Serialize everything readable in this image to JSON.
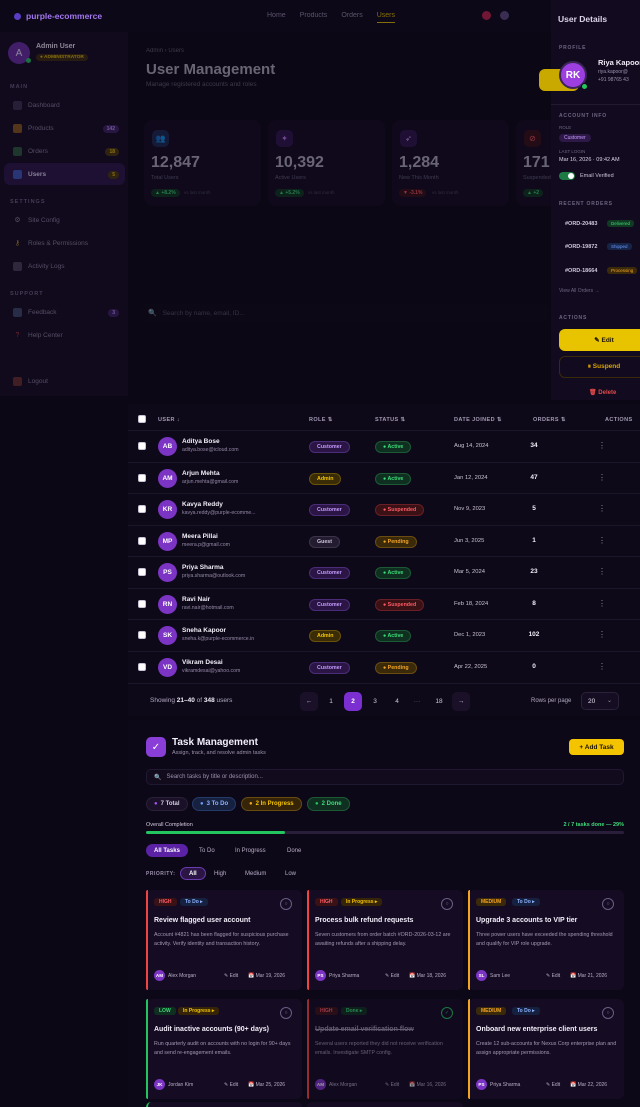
{
  "nav": {
    "brand": "purple-ecommerce",
    "links": [
      "Home",
      "Products",
      "Orders",
      "Users"
    ],
    "active": "Users"
  },
  "sidebar": {
    "user": {
      "initial": "A",
      "name": "Admin User",
      "role": "● ADMINISTRATOR"
    },
    "sections": {
      "main": "MAIN",
      "settings": "SETTINGS",
      "support": "SUPPORT"
    },
    "items": [
      {
        "label": "Dashboard",
        "badge": ""
      },
      {
        "label": "Products",
        "badge": "142"
      },
      {
        "label": "Orders",
        "badge": "18"
      },
      {
        "label": "Users",
        "badge": "5"
      },
      {
        "label": "Site Config",
        "badge": ""
      },
      {
        "label": "Roles & Permissions",
        "badge": ""
      },
      {
        "label": "Activity Logs",
        "badge": ""
      },
      {
        "label": "Feedback",
        "badge": "3"
      },
      {
        "label": "Help Center",
        "badge": ""
      },
      {
        "label": "Logout",
        "badge": ""
      }
    ]
  },
  "header": {
    "breadcrumb": "Admin › Users",
    "title": "User Management",
    "subtitle": "Manage registered accounts and roles"
  },
  "stats": [
    {
      "value": "12,847",
      "label": "Total Users",
      "change": "▲ +8.2%",
      "vs": "vs last month"
    },
    {
      "value": "10,392",
      "label": "Active Users",
      "change": "▲ +5.2%",
      "vs": "vs last month"
    },
    {
      "value": "1,284",
      "label": "New This Month",
      "change": "▼ -3.1%",
      "vs": "vs last month"
    },
    {
      "value": "171",
      "label": "Suspended",
      "change": "▲ +2",
      "vs": ""
    }
  ],
  "search": {
    "placeholder": "Search by name, email, ID..."
  },
  "panel": {
    "title": "User Details",
    "profile_label": "PROFILE",
    "initials": "RK",
    "name": "Riya Kapoor",
    "email": "riya.kapoor@",
    "phone": "+91 98765 43",
    "account_label": "ACCOUNT INFO",
    "role_label": "ROLE",
    "role": "Customer",
    "last_login_label": "LAST LOGIN",
    "last_login": "Mar 16, 2026 · 09:42 AM",
    "email_verified": "Email Verified",
    "orders_label": "RECENT ORDERS",
    "orders": [
      {
        "id": "#ORD-20483",
        "status": "Delivered"
      },
      {
        "id": "#ORD-19872",
        "status": "Shipped"
      },
      {
        "id": "#ORD-18664",
        "status": "Processing"
      }
    ],
    "view_all": "View All Orders →",
    "actions_label": "ACTIONS",
    "edit": "✎ Edit",
    "suspend": "⏸ Suspend",
    "delete": "🗑 Delete"
  },
  "table": {
    "headers": {
      "user": "USER ↓",
      "role": "ROLE ⇅",
      "status": "STATUS ⇅",
      "date": "DATE JOINED ⇅",
      "orders": "ORDERS ⇅",
      "actions": "ACTIONS"
    },
    "rows": [
      {
        "initials": "AB",
        "name": "Aditya Bose",
        "email": "aditya.bose@icloud.com",
        "role": "Customer",
        "status": "● Active",
        "date": "Aug 14, 2024",
        "orders": "34"
      },
      {
        "initials": "AM",
        "name": "Arjun Mehta",
        "email": "arjun.mehta@gmail.com",
        "role": "Admin",
        "status": "● Active",
        "date": "Jan 12, 2024",
        "orders": "47"
      },
      {
        "initials": "KR",
        "name": "Kavya Reddy",
        "email": "kavya.reddy@purple-ecomme...",
        "role": "Customer",
        "status": "● Suspended",
        "date": "Nov 9, 2023",
        "orders": "5"
      },
      {
        "initials": "MP",
        "name": "Meera Pillai",
        "email": "meera.p@gmail.com",
        "role": "Guest",
        "status": "● Pending",
        "date": "Jun 3, 2025",
        "orders": "1"
      },
      {
        "initials": "PS",
        "name": "Priya Sharma",
        "email": "priya.sharma@outlook.com",
        "role": "Customer",
        "status": "● Active",
        "date": "Mar 5, 2024",
        "orders": "23"
      },
      {
        "initials": "RN",
        "name": "Ravi Nair",
        "email": "ravi.nair@hotmail.com",
        "role": "Customer",
        "status": "● Suspended",
        "date": "Feb 18, 2024",
        "orders": "8"
      },
      {
        "initials": "SK",
        "name": "Sneha Kapoor",
        "email": "sneha.k@purple-ecommerce.in",
        "role": "Admin",
        "status": "● Active",
        "date": "Dec 1, 2023",
        "orders": "102"
      },
      {
        "initials": "VD",
        "name": "Vikram Desai",
        "email": "vikramdesai@yahoo.com",
        "role": "Customer",
        "status": "● Pending",
        "date": "Apr 22, 2025",
        "orders": "0"
      }
    ],
    "showing_prefix": "Showing ",
    "showing_range": "21–40",
    "showing_of": " of ",
    "showing_total": "348",
    "showing_suffix": " users",
    "pages": [
      "←",
      "1",
      "2",
      "3",
      "4",
      "···",
      "18",
      "→"
    ],
    "active_page": "2",
    "rows_per_page_label": "Rows per page",
    "rows_per_page": "20"
  },
  "tasks": {
    "title": "Task Management",
    "subtitle": "Assign, track, and resolve admin tasks",
    "add_button": "+ Add Task",
    "search_placeholder": "Search tasks by title or description...",
    "chips": [
      "7 Total",
      "3 To Do",
      "2 In Progress",
      "2 Done"
    ],
    "completion_label": "Overall Completion",
    "completion_text": "2 / 7 tasks done — 29%",
    "completion_pct": 29,
    "status_tabs": [
      "All Tasks",
      "To Do",
      "In Progress",
      "Done"
    ],
    "priority_label": "PRIORITY:",
    "priority_tabs": [
      "All",
      "High",
      "Medium",
      "Low"
    ],
    "cards": [
      {
        "priority": "HIGH",
        "status": "To Do ▸",
        "title": "Review flagged user account",
        "desc": "Account #4821 has been flagged for suspicious purchase activity. Verify identity and transaction history.",
        "initials": "AM",
        "assignee": "Alex Morgan",
        "edit": "✎ Edit",
        "date": "📅 Mar 19, 2026"
      },
      {
        "priority": "HIGH",
        "status": "In Progress ▸",
        "title": "Process bulk refund requests",
        "desc": "Seven customers from order batch #ORD-2026-03-12 are awaiting refunds after a shipping delay.",
        "initials": "PS",
        "assignee": "Priya Sharma",
        "edit": "✎ Edit",
        "date": "📅 Mar 18, 2026"
      },
      {
        "priority": "MEDIUM",
        "status": "To Do ▸",
        "title": "Upgrade 3 accounts to VIP tier",
        "desc": "Three power users have exceeded the spending threshold and qualify for VIP role upgrade.",
        "initials": "SL",
        "assignee": "Sam Lee",
        "edit": "✎ Edit",
        "date": "📅 Mar 21, 2026"
      },
      {
        "priority": "LOW",
        "status": "In Progress ▸",
        "title": "Audit inactive accounts (90+ days)",
        "desc": "Run quarterly audit on accounts with no login for 90+ days and send re-engagement emails.",
        "initials": "JK",
        "assignee": "Jordan Kim",
        "edit": "✎ Edit",
        "date": "📅 Mar 25, 2026"
      },
      {
        "priority": "HIGH",
        "status": "Done ▸",
        "title": "Update email verification flow",
        "desc": "Several users reported they did not receive verification emails. Investigate SMTP config.",
        "initials": "AM",
        "assignee": "Alex Morgan",
        "edit": "✎ Edit",
        "date": "📅 Mar 16, 2026"
      },
      {
        "priority": "MEDIUM",
        "status": "To Do ▸",
        "title": "Onboard new enterprise client users",
        "desc": "Create 12 sub-accounts for Nexus Corp enterprise plan and assign appropriate permissions.",
        "initials": "PS",
        "assignee": "Priya Sharma",
        "edit": "✎ Edit",
        "date": "📅 Mar 22, 2026"
      }
    ]
  },
  "colors": {
    "accent": "#a855f7",
    "yellow": "#f5c400",
    "active": "#22c55e",
    "suspended": "#ef4444",
    "pending": "#f59e0b"
  }
}
